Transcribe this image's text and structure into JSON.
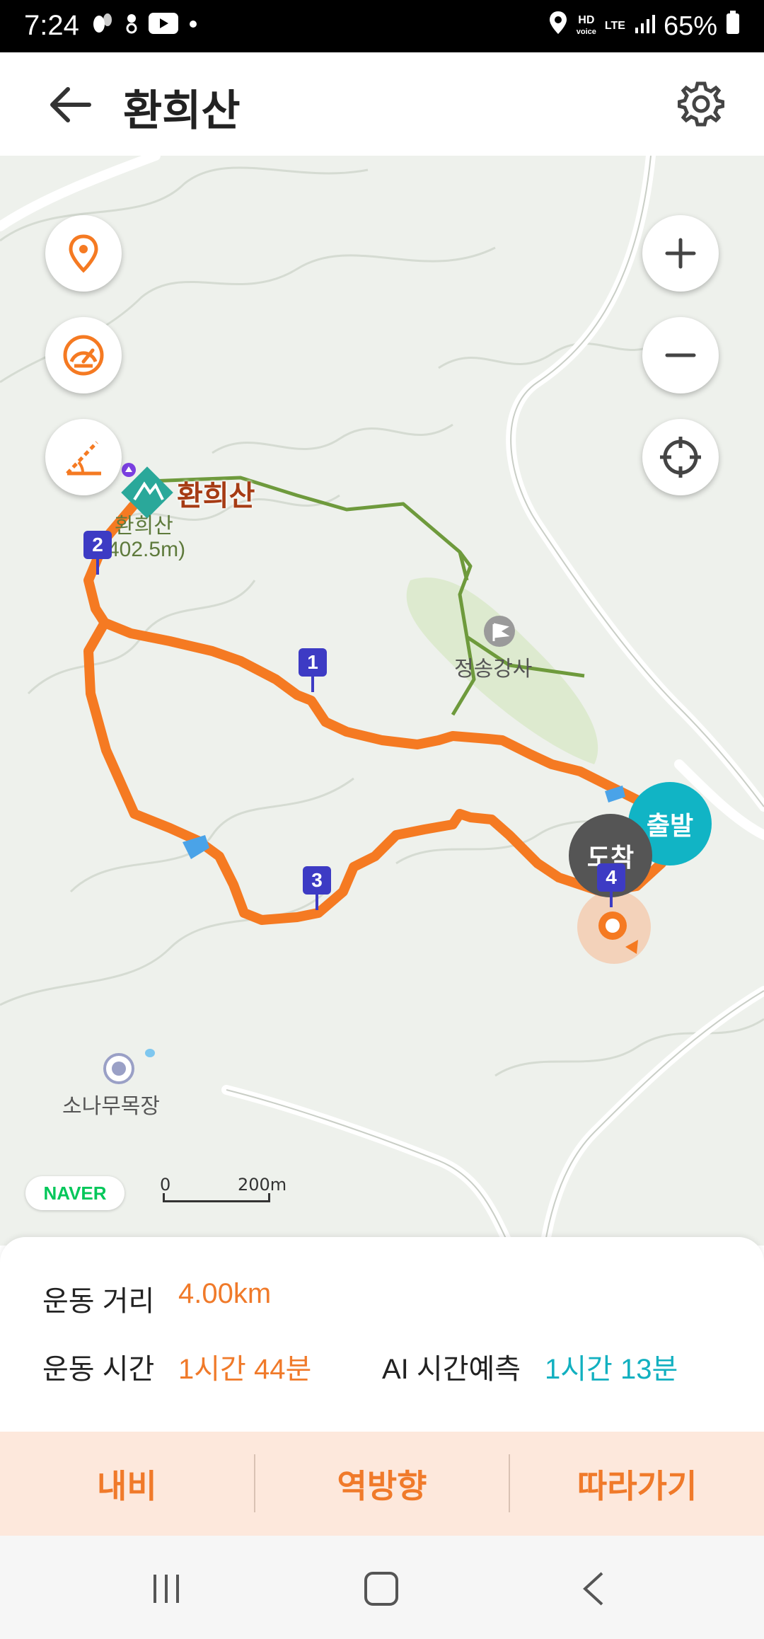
{
  "status_bar": {
    "time": "7:24",
    "battery": "65%",
    "hd_label": "HD",
    "voice_label": "voice",
    "lte_label": "LTE",
    "icons": [
      "steps-icon",
      "notification-dot-icon",
      "youtube-icon",
      "dot-icon",
      "location-icon",
      "hd-voice-icon",
      "lte-icon",
      "signal-icon",
      "battery-icon"
    ]
  },
  "header": {
    "title": "환희산",
    "back_icon": "arrow-left-icon",
    "settings_icon": "gear-icon"
  },
  "map": {
    "peak_name": "환희산",
    "peak_info_name": "환희산",
    "peak_info_elev": "402.5m)",
    "temple": "정송강사",
    "ranch": "소나무목장",
    "start_label": "출발",
    "end_label": "도착",
    "waypoints": [
      "1",
      "2",
      "3",
      "4"
    ],
    "naver": "NAVER",
    "scale_zero": "0",
    "scale_dist": "200m",
    "route_color": "#f57a22",
    "trail_color": "#6e9a3c"
  },
  "stats": {
    "distance_label": "운동 거리",
    "distance_value": "4.00km",
    "time_label": "운동 시간",
    "time_value": "1시간 44분",
    "ai_label": "AI 시간예측",
    "ai_value": "1시간 13분"
  },
  "actions": {
    "navi": "내비",
    "reverse": "역방향",
    "follow": "따라가기"
  }
}
